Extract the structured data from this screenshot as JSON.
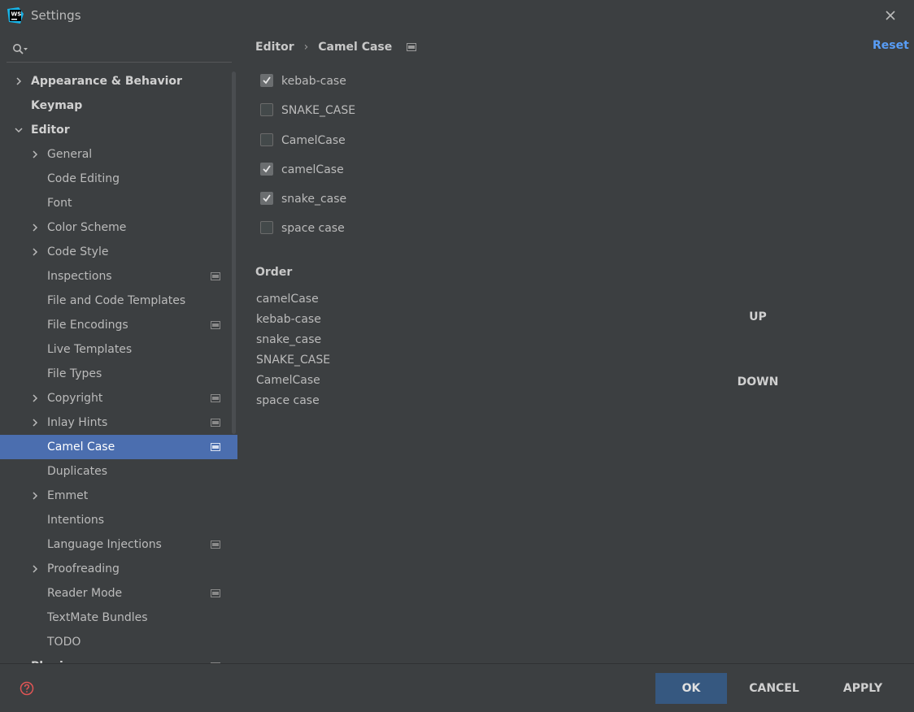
{
  "window": {
    "title": "Settings",
    "logo_text": "WS"
  },
  "sidebar": {
    "search_placeholder": "",
    "items": [
      {
        "label": "Appearance & Behavior",
        "level": 0,
        "expandable": true,
        "expanded": false,
        "bold": true
      },
      {
        "label": "Keymap",
        "level": 0,
        "expandable": false,
        "bold": true
      },
      {
        "label": "Editor",
        "level": 0,
        "expandable": true,
        "expanded": true,
        "bold": true
      },
      {
        "label": "General",
        "level": 1,
        "expandable": true
      },
      {
        "label": "Code Editing",
        "level": 1
      },
      {
        "label": "Font",
        "level": 1
      },
      {
        "label": "Color Scheme",
        "level": 1,
        "expandable": true
      },
      {
        "label": "Code Style",
        "level": 1,
        "expandable": true
      },
      {
        "label": "Inspections",
        "level": 1,
        "project_icon": true
      },
      {
        "label": "File and Code Templates",
        "level": 1
      },
      {
        "label": "File Encodings",
        "level": 1,
        "project_icon": true
      },
      {
        "label": "Live Templates",
        "level": 1
      },
      {
        "label": "File Types",
        "level": 1
      },
      {
        "label": "Copyright",
        "level": 1,
        "expandable": true,
        "project_icon": true
      },
      {
        "label": "Inlay Hints",
        "level": 1,
        "expandable": true,
        "project_icon": true
      },
      {
        "label": "Camel Case",
        "level": 1,
        "selected": true,
        "project_icon": true
      },
      {
        "label": "Duplicates",
        "level": 1
      },
      {
        "label": "Emmet",
        "level": 1,
        "expandable": true
      },
      {
        "label": "Intentions",
        "level": 1
      },
      {
        "label": "Language Injections",
        "level": 1,
        "project_icon": true
      },
      {
        "label": "Proofreading",
        "level": 1,
        "expandable": true
      },
      {
        "label": "Reader Mode",
        "level": 1,
        "project_icon": true
      },
      {
        "label": "TextMate Bundles",
        "level": 1
      },
      {
        "label": "TODO",
        "level": 1
      },
      {
        "label": "Plugins",
        "level": 0,
        "bold": true,
        "project_icon": true
      }
    ]
  },
  "breadcrumb": {
    "parent": "Editor",
    "current": "Camel Case"
  },
  "reset_label": "Reset",
  "checkboxes": [
    {
      "label": "kebab-case",
      "checked": true
    },
    {
      "label": "SNAKE_CASE",
      "checked": false
    },
    {
      "label": "CamelCase",
      "checked": false
    },
    {
      "label": "camelCase",
      "checked": true
    },
    {
      "label": "snake_case",
      "checked": true
    },
    {
      "label": "space case",
      "checked": false
    }
  ],
  "order": {
    "title": "Order",
    "items": [
      "camelCase",
      "kebab-case",
      "snake_case",
      "SNAKE_CASE",
      "CamelCase",
      "space case"
    ],
    "up_label": "UP",
    "down_label": "DOWN"
  },
  "footer": {
    "ok_label": "OK",
    "cancel_label": "CANCEL",
    "apply_label": "APPLY"
  },
  "colors": {
    "background": "#3c3f41",
    "selection": "#4b6eaf",
    "link": "#589df6",
    "ok_button": "#365880",
    "help": "#e05555"
  }
}
